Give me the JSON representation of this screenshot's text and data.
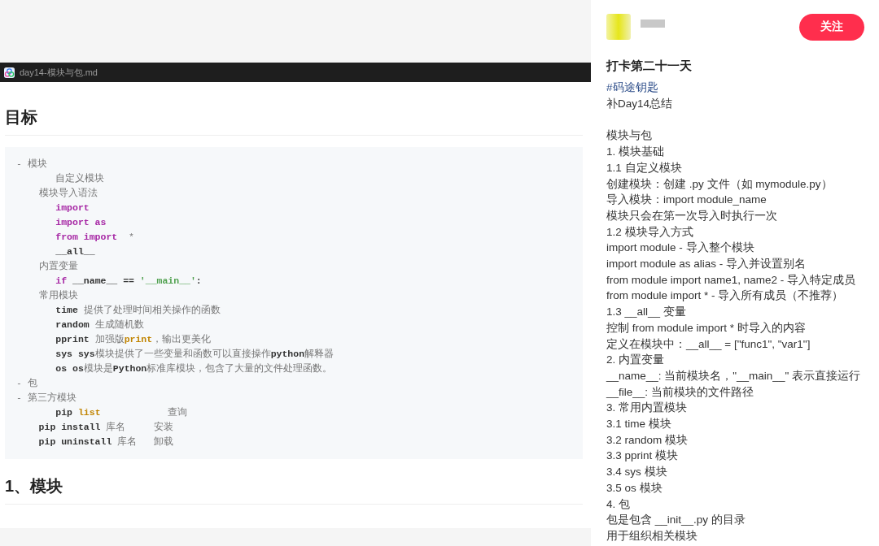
{
  "editor": {
    "tab": {
      "title": "day14-模块与包.md"
    },
    "heading": "目标",
    "code_lines": [
      [
        {
          "text": "- 模块",
          "kind": "text"
        }
      ],
      [
        {
          "text": "       自定义模块",
          "kind": "text"
        }
      ],
      [
        {
          "text": "    模块导入语法",
          "kind": "text"
        }
      ],
      [
        {
          "text": "       import",
          "kind": "keyword"
        }
      ],
      [
        {
          "text": "       import as",
          "kind": "keyword"
        }
      ],
      [
        {
          "text": "       from import",
          "kind": "keyword"
        },
        {
          "text": "  *",
          "kind": "text"
        }
      ],
      [
        {
          "text": "       __all__",
          "kind": "code"
        }
      ],
      [
        {
          "text": "    内置变量",
          "kind": "text"
        }
      ],
      [
        {
          "text": "       if",
          "kind": "keyword"
        },
        {
          "text": " __name__ == ",
          "kind": "code"
        },
        {
          "text": "'__main__'",
          "kind": "string"
        },
        {
          "text": ":",
          "kind": "code"
        }
      ],
      [
        {
          "text": "    常用模块",
          "kind": "text"
        }
      ],
      [
        {
          "text": "       time ",
          "kind": "code"
        },
        {
          "text": "提供了处理时间相关操作的函数",
          "kind": "text"
        }
      ],
      [
        {
          "text": "       random ",
          "kind": "code"
        },
        {
          "text": "生成随机数",
          "kind": "text"
        }
      ],
      [
        {
          "text": "       pprint ",
          "kind": "code"
        },
        {
          "text": "加强版",
          "kind": "text"
        },
        {
          "text": "print",
          "kind": "builtin"
        },
        {
          "text": "，输出更美化",
          "kind": "text"
        }
      ],
      [
        {
          "text": "       sys sys",
          "kind": "code"
        },
        {
          "text": "模块提供了一些变量和函数可以直接操作",
          "kind": "text"
        },
        {
          "text": "python",
          "kind": "code"
        },
        {
          "text": "解释器",
          "kind": "text"
        }
      ],
      [
        {
          "text": "       os os",
          "kind": "code"
        },
        {
          "text": "模块是",
          "kind": "text"
        },
        {
          "text": "Python",
          "kind": "code"
        },
        {
          "text": "标准库模块，包含了大量的文件处理函数。",
          "kind": "text"
        }
      ],
      [
        {
          "text": "- 包",
          "kind": "text"
        }
      ],
      [
        {
          "text": "- 第三方模块",
          "kind": "text"
        }
      ],
      [
        {
          "text": "       pip ",
          "kind": "code"
        },
        {
          "text": "list",
          "kind": "builtin"
        },
        {
          "text": "            查询",
          "kind": "text"
        }
      ],
      [
        {
          "text": "    pip install ",
          "kind": "code"
        },
        {
          "text": "库名     安装",
          "kind": "text"
        }
      ],
      [
        {
          "text": "    pip uninstall ",
          "kind": "code"
        },
        {
          "text": "库名   卸载",
          "kind": "text"
        }
      ]
    ],
    "heading_2": "1、模块"
  },
  "post": {
    "follow_button": "关注",
    "title": "打卡第二十一天",
    "hashtag": "#码途钥匙",
    "intro": "补Day14总结",
    "lines": [
      "模块与包",
      "1. 模块基础",
      "1.1 自定义模块",
      "创建模块：创建 .py 文件（如 mymodule.py）",
      "导入模块：import module_name",
      "模块只会在第一次导入时执行一次",
      "1.2 模块导入方式",
      "import module - 导入整个模块",
      "import module as alias - 导入并设置别名",
      "from module import name1, name2 - 导入特定成员",
      "from module import * - 导入所有成员（不推荐）",
      "1.3 __all__ 变量",
      "控制 from module import * 时导入的内容",
      "定义在模块中：__all__ = [\"func1\", \"var1\"]",
      "2. 内置变量",
      "__name__: 当前模块名，\"__main__\" 表示直接运行",
      "__file__: 当前模块的文件路径",
      "3. 常用内置模块",
      "3.1 time 模块",
      "3.2 random 模块",
      "3.3 pprint 模块",
      "3.4 sys 模块",
      "3.5 os 模块",
      "4. 包",
      "包是包含 __init__.py 的目录",
      "用于组织相关模块"
    ]
  }
}
